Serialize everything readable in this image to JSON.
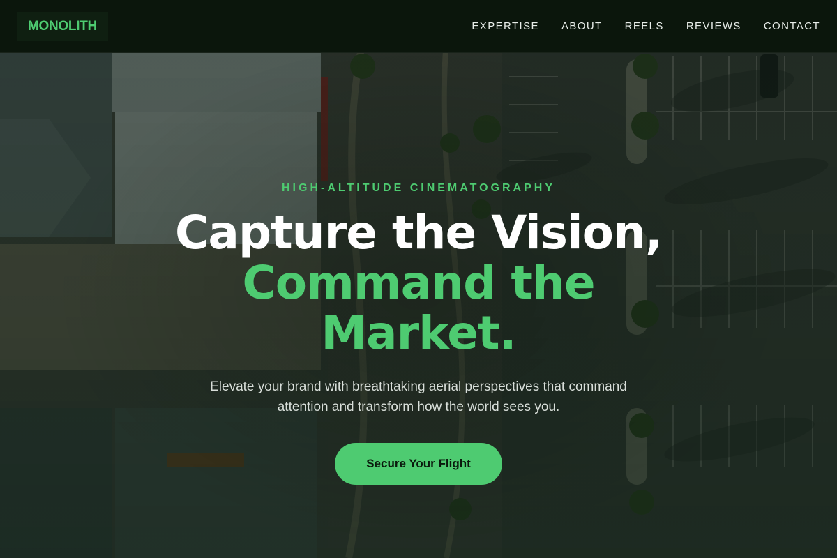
{
  "brand": {
    "name": "MONOLITH"
  },
  "nav": {
    "items": [
      {
        "label": "EXPERTISE"
      },
      {
        "label": "ABOUT"
      },
      {
        "label": "REELS"
      },
      {
        "label": "REVIEWS"
      },
      {
        "label": "CONTACT"
      }
    ]
  },
  "hero": {
    "eyebrow": "HIGH-ALTITUDE CINEMATOGRAPHY",
    "headline_line1": "Capture the Vision,",
    "headline_line2": "Command the",
    "headline_line3": "Market.",
    "subtitle": "Elevate your brand with breathtaking aerial perspectives that command attention and transform how the world sees you.",
    "cta_label": "Secure Your Flight"
  },
  "colors": {
    "accent": "#4ecb71",
    "nav_background": "#0b160c",
    "text_primary": "#ffffff"
  }
}
